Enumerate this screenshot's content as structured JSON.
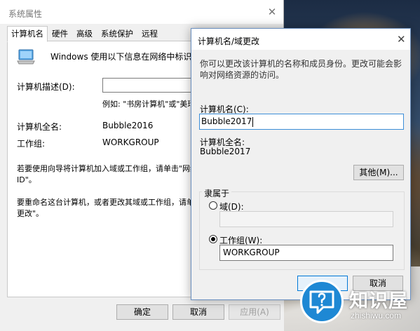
{
  "system_properties": {
    "title": "系统属性",
    "close_glyph": "✕",
    "tabs": [
      {
        "label": "计算机名",
        "active": true
      },
      {
        "label": "硬件"
      },
      {
        "label": "高级"
      },
      {
        "label": "系统保护"
      },
      {
        "label": "远程"
      }
    ],
    "intro": "Windows 使用以下信息在网络中标识这台计",
    "description_label": "计算机描述(D):",
    "description_value": "",
    "description_example": "例如: \"书房计算机\"或\"美玲的",
    "full_name_label": "计算机全名:",
    "full_name_value": "Bubble2016",
    "workgroup_label": "工作组:",
    "workgroup_value": "WORKGROUP",
    "wizard_text_line1": "若要使用向导将计算机加入域或工作组，请单击\"网络",
    "wizard_text_line2": "ID\"。",
    "rename_text_line1": "要重命名这台计算机，或者更改其域或工作组，请单击\"",
    "rename_text_line2": "更改\"。",
    "buttons": {
      "ok": "确定",
      "cancel": "取消",
      "apply": "应用(A)"
    }
  },
  "dialog": {
    "title": "计算机名/域更改",
    "close_glyph": "✕",
    "intro": "你可以更改该计算机的名称和成员身份。更改可能会影响对网络资源的访问。",
    "computer_name_label": "计算机名(C):",
    "computer_name_value": "Bubble2017",
    "full_name_label": "计算机全名:",
    "full_name_value": "Bubble2017",
    "other_button": "其他(M)...",
    "member_of_label": "隶属于",
    "domain_label": "域(D):",
    "domain_value": "",
    "workgroup_label": "工作组(W):",
    "workgroup_value": "WORKGROUP",
    "selected_membership": "workgroup",
    "ok_button": "",
    "cancel_button": "取消"
  },
  "watermark": {
    "text": "知识屋",
    "subtext": "zhishiwu.com"
  },
  "colors": {
    "focus_border": "#3c8ed8",
    "primary_button_border": "#0078d7",
    "logo_blue": "#1e88d4"
  }
}
